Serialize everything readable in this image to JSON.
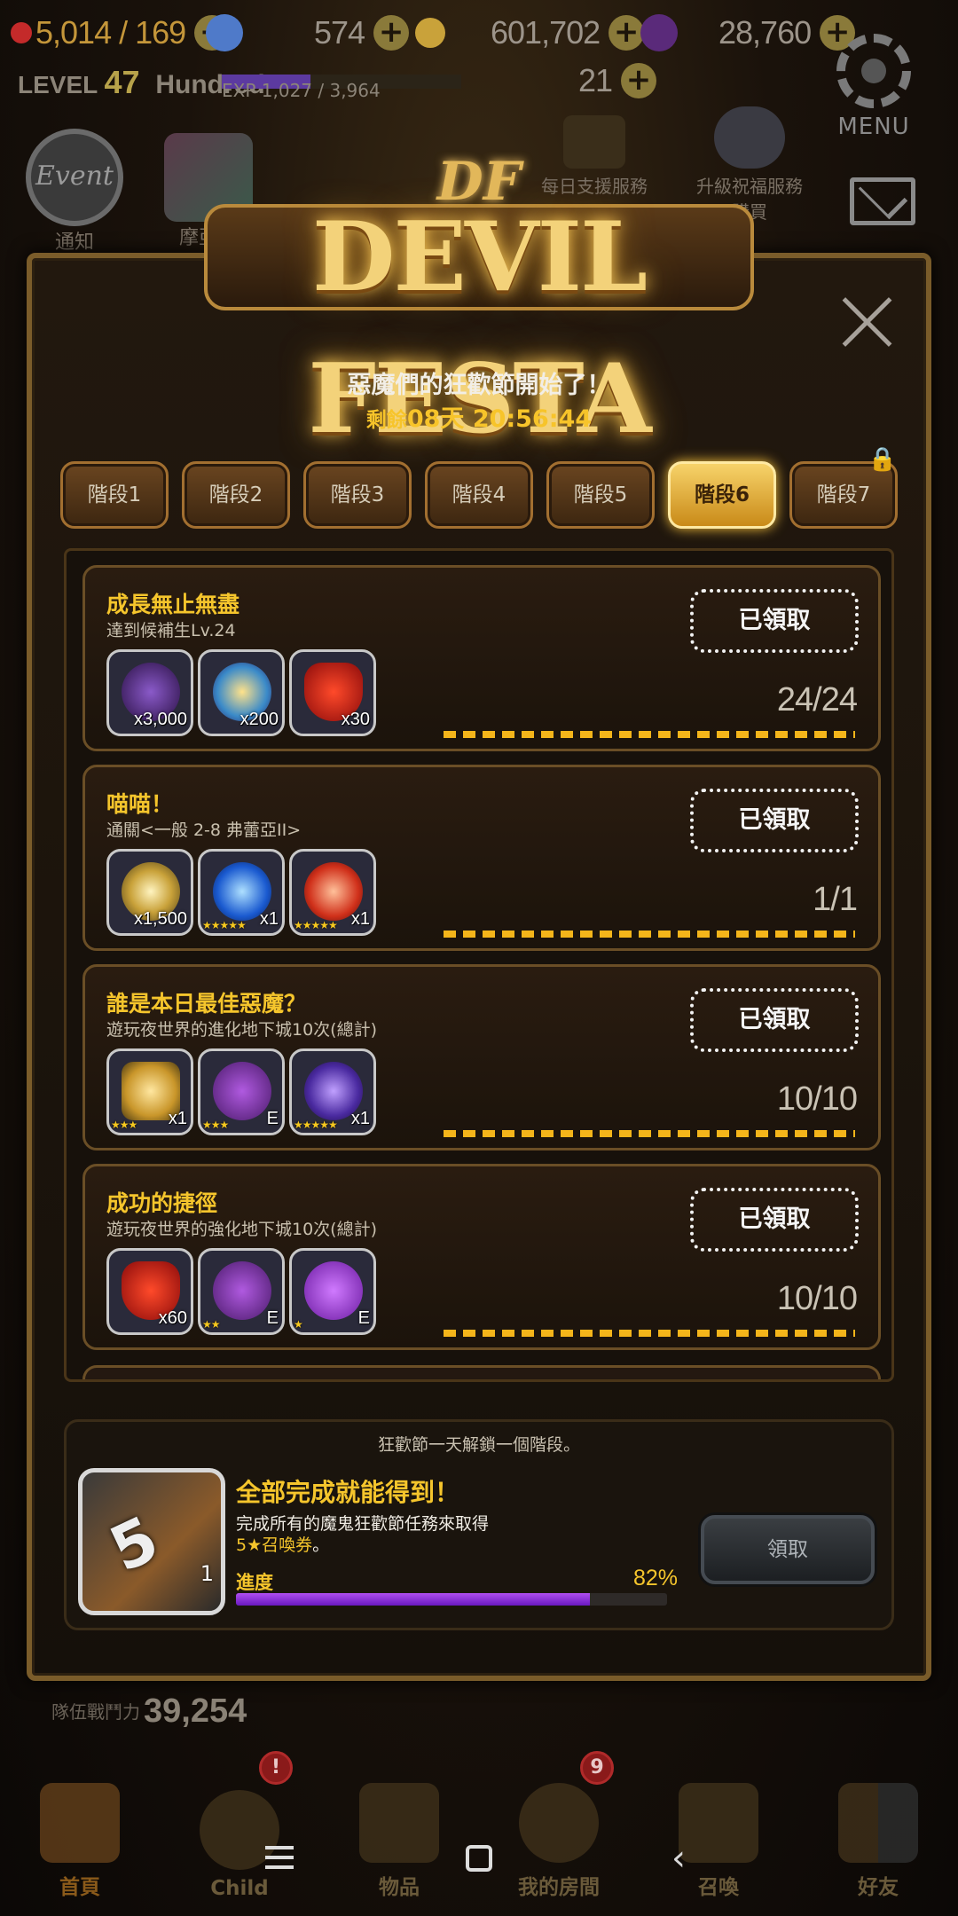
{
  "resources": [
    {
      "icon": "heart-icon",
      "value": "5,014 / 169",
      "color": "#c42a2a"
    },
    {
      "icon": "gem-icon",
      "value": "574",
      "color": "#4f7ac9"
    },
    {
      "icon": "gold-coin-icon",
      "value": "601,702",
      "color": "#c9a23a"
    },
    {
      "icon": "dark-crystal-icon",
      "value": "28,760",
      "color": "#5a2a7a"
    }
  ],
  "player": {
    "level_label": "LEVEL",
    "level": "47",
    "name": "Hundred",
    "exp": "EXP 1,027 / 3,964",
    "ticket_count": "21"
  },
  "menu": {
    "label": "MENU"
  },
  "background_icons": {
    "event_medal": "Event",
    "event_label": "通知",
    "cube_label": "摩亞原",
    "daily_support": "每日支援服務",
    "daily_support2": "購買",
    "upgrade_blessing": "升級祝福服務",
    "upgrade_blessing2": "購買"
  },
  "banner": {
    "crest": "DF",
    "logo": "DEVIL FESTA"
  },
  "festival": {
    "headline": "惡魔們的狂歡節開始了！",
    "remain_prefix": "剩餘",
    "remain_time": "08天 20:56:44"
  },
  "tabs": [
    {
      "label": "階段1",
      "active": false,
      "locked": false
    },
    {
      "label": "階段2",
      "active": false,
      "locked": false
    },
    {
      "label": "階段3",
      "active": false,
      "locked": false
    },
    {
      "label": "階段4",
      "active": false,
      "locked": false
    },
    {
      "label": "階段5",
      "active": false,
      "locked": false
    },
    {
      "label": "階段6",
      "active": true,
      "locked": false
    },
    {
      "label": "階段7",
      "active": false,
      "locked": true
    }
  ],
  "missions": [
    {
      "title": "成長無止無盡",
      "desc": "達到候補生Lv.24",
      "status": "已領取",
      "progress": "24/24",
      "rewards": [
        {
          "icon": "dark-gem-icon",
          "qty": "x3,000",
          "stars": "",
          "color": "#3a1a5a"
        },
        {
          "icon": "rainbow-gem-icon",
          "qty": "x200",
          "stars": "",
          "color": "#3a5a8a"
        },
        {
          "icon": "heart-icon",
          "qty": "x30",
          "stars": "",
          "color": "#3a2222"
        }
      ]
    },
    {
      "title": "喵喵！",
      "desc": "通關<一般 2-8 弗蕾亞II>",
      "status": "已領取",
      "progress": "1/1",
      "rewards": [
        {
          "icon": "gold-coin-icon",
          "qty": "x1,500",
          "stars": "",
          "color": "#4a3a12"
        },
        {
          "icon": "blue-gem-icon",
          "qty": "x1",
          "stars": "★★★★★",
          "color": "#12305a"
        },
        {
          "icon": "red-gem-icon",
          "qty": "x1",
          "stars": "★★★★★",
          "color": "#5a1a12"
        }
      ]
    },
    {
      "title": "誰是本日最佳惡魔？",
      "desc": "遊玩夜世界的進化地下城10次(總計)",
      "status": "已領取",
      "progress": "10/10",
      "rewards": [
        {
          "icon": "coin-pile-icon",
          "qty": "x1",
          "stars": "★★★",
          "color": "#4a3a12"
        },
        {
          "icon": "purple-devil-icon",
          "qty": "E",
          "stars": "★★★",
          "color": "#4a1a6a"
        },
        {
          "icon": "purple-gem-icon",
          "qty": "x1",
          "stars": "★★★★★",
          "color": "#2a1a5a"
        }
      ]
    },
    {
      "title": "成功的捷徑",
      "desc": "遊玩夜世界的強化地下城10次(總計)",
      "status": "已領取",
      "progress": "10/10",
      "rewards": [
        {
          "icon": "heart-icon",
          "qty": "x60",
          "stars": "",
          "color": "#3a2222"
        },
        {
          "icon": "purple-devil-icon",
          "qty": "E",
          "stars": "★★",
          "color": "#4a1a6a"
        },
        {
          "icon": "purple-slime-icon",
          "qty": "E",
          "stars": "★",
          "color": "#5a1a8a"
        }
      ]
    }
  ],
  "final_reward": {
    "unlock_note": "狂歡節一天解鎖一個階段。",
    "title": "全部完成就能得到！",
    "desc_line1": "完成所有的魔鬼狂歡節任務來取得",
    "desc_line2": "5★召喚券",
    "desc_line2_suffix": "。",
    "ticket_qty": "1",
    "progress_label": "進度",
    "progress_pct": "82%",
    "progress_value": 0.82,
    "claim_label": "領取"
  },
  "team_power": {
    "label": "隊伍戰鬥力",
    "value": "39,254"
  },
  "bottom_nav": [
    {
      "label": "首頁",
      "badge": ""
    },
    {
      "label": "Child",
      "badge": "!"
    },
    {
      "label": "物品",
      "badge": ""
    },
    {
      "label": "我的房間",
      "badge": "9"
    },
    {
      "label": "召喚",
      "badge": ""
    },
    {
      "label": "好友",
      "badge": ""
    }
  ]
}
